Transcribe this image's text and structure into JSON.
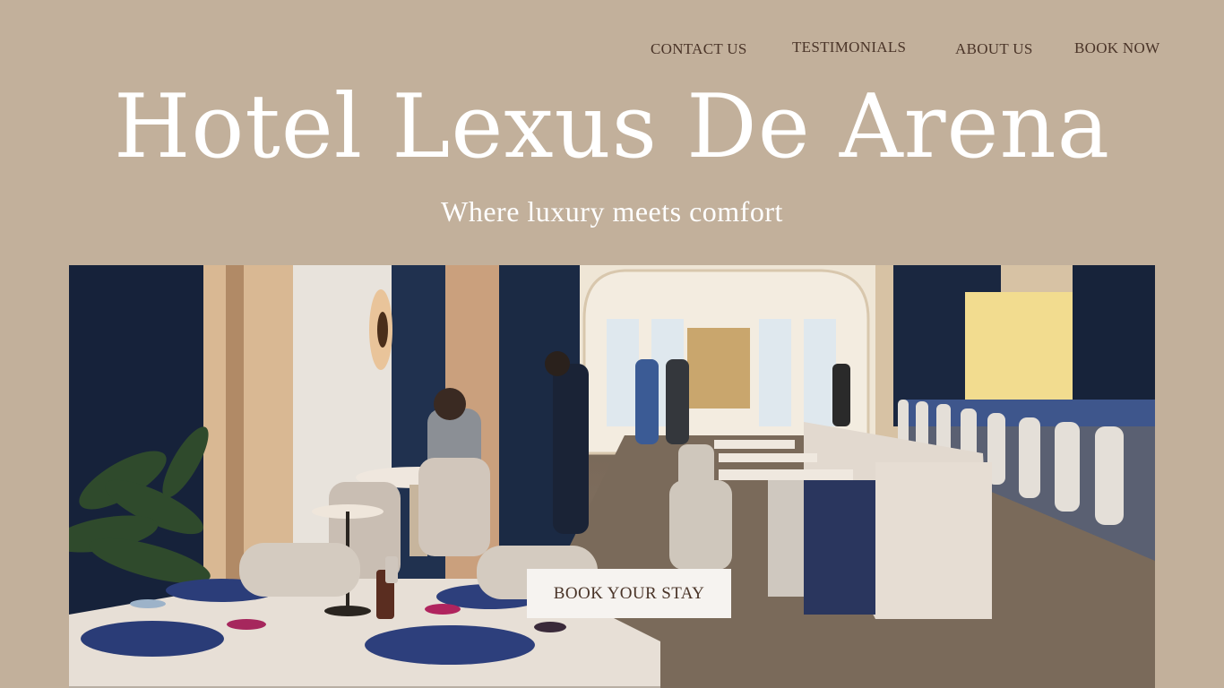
{
  "nav": {
    "contact": "CONTACT US",
    "testimonials": "TESTIMONIALS",
    "about": "ABOUT US",
    "book": "BOOK NOW"
  },
  "hero": {
    "title": "Hotel Lexus De Arena",
    "subtitle": "Where luxury meets comfort",
    "cta_label": "BOOK YOUR STAY"
  },
  "colors": {
    "background": "#c2b09b",
    "nav_text": "#4a3428",
    "title_text": "#ffffff",
    "cta_bg": "#f6f3f0"
  }
}
